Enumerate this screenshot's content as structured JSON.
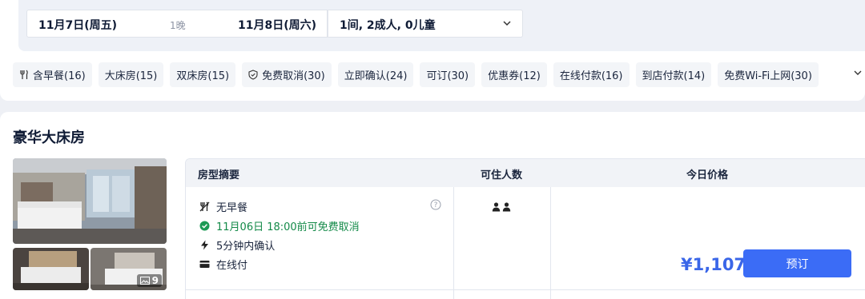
{
  "search": {
    "checkin": "11月7日(周五)",
    "nights": "1晚",
    "checkout": "11月8日(周六)",
    "guests": "1间, 2成人, 0儿童"
  },
  "filters": [
    {
      "label": "含早餐(16)",
      "icon": "fork-knife-icon"
    },
    {
      "label": "大床房(15)"
    },
    {
      "label": "双床房(15)"
    },
    {
      "label": "免费取消(30)",
      "icon": "shield-icon"
    },
    {
      "label": "立即确认(24)"
    },
    {
      "label": "可订(30)"
    },
    {
      "label": "优惠券(12)"
    },
    {
      "label": "在线付款(16)"
    },
    {
      "label": "到店付款(14)"
    },
    {
      "label": "免费Wi-Fi上网(30)"
    }
  ],
  "room": {
    "title": "豪华大床房",
    "photo_count": "9",
    "table": {
      "col_summary": "房型摘要",
      "col_occupancy": "可住人数",
      "col_price": "今日价格"
    },
    "rate": {
      "meal": "无早餐",
      "cancel": "11月06日 18:00前可免费取消",
      "confirm": "5分钟内确认",
      "payment": "在线付",
      "occupancy_count": 2,
      "price": "¥1,107",
      "book_label": "预订"
    }
  },
  "colors": {
    "accent": "#3b6cf6",
    "price": "#3a66e8",
    "cancel_green": "#138a48"
  }
}
